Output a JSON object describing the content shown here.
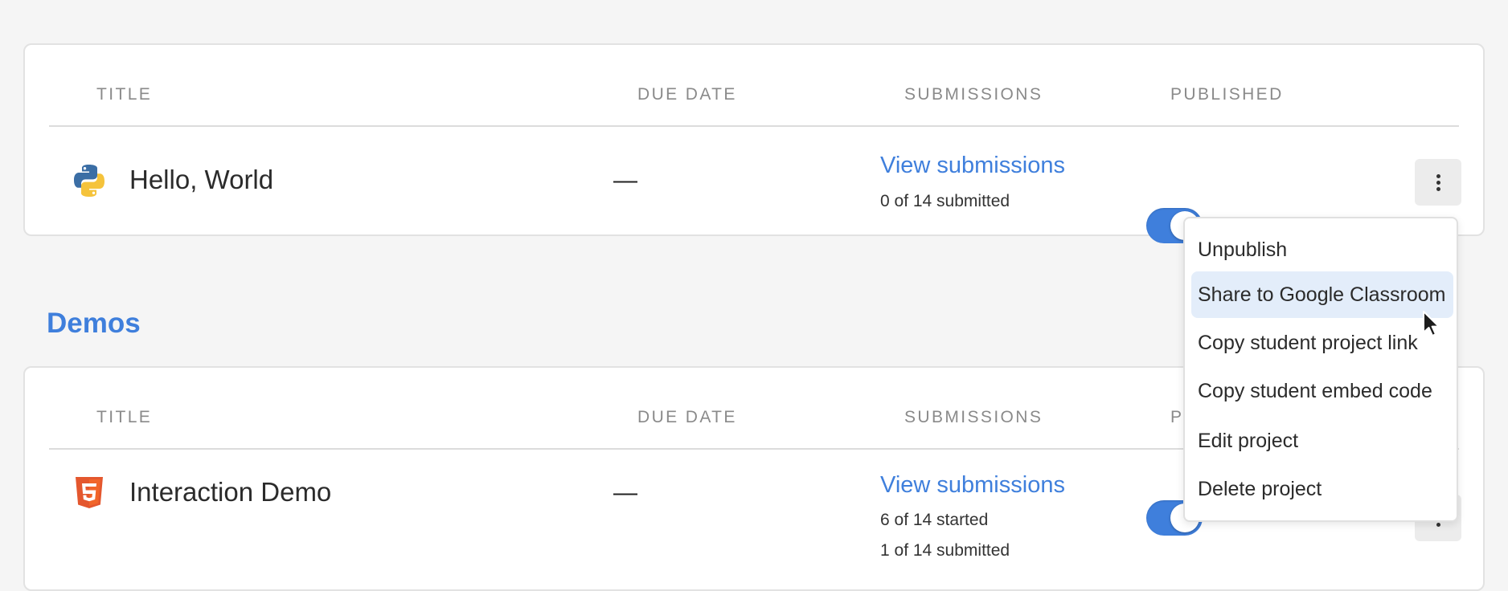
{
  "table_headers": {
    "title": "TITLE",
    "due_date": "DUE DATE",
    "submissions": "SUBMISSIONS",
    "published": "PUBLISHED"
  },
  "projects": [
    {
      "title": "Hello, World",
      "language_icon": "python-icon",
      "due": "—",
      "view_link": "View submissions",
      "status_lines": [
        "0 of 14 submitted"
      ],
      "published": true
    },
    {
      "title": "Interaction Demo",
      "language_icon": "html5-icon",
      "due": "—",
      "view_link": "View submissions",
      "status_lines": [
        "6 of 14 started",
        "1 of 14 submitted"
      ],
      "published": true
    }
  ],
  "sections": {
    "demos_title": "Demos"
  },
  "dropdown": {
    "items": [
      "Unpublish",
      "Share to Google Classroom",
      "Copy student project link",
      "Copy student embed code",
      "Edit project",
      "Delete project"
    ],
    "hovered_item": "Share to Google Classroom"
  },
  "colors": {
    "accent": "#3f7fdc",
    "menu_hover": "#e3edfa",
    "background": "#f5f5f5"
  }
}
